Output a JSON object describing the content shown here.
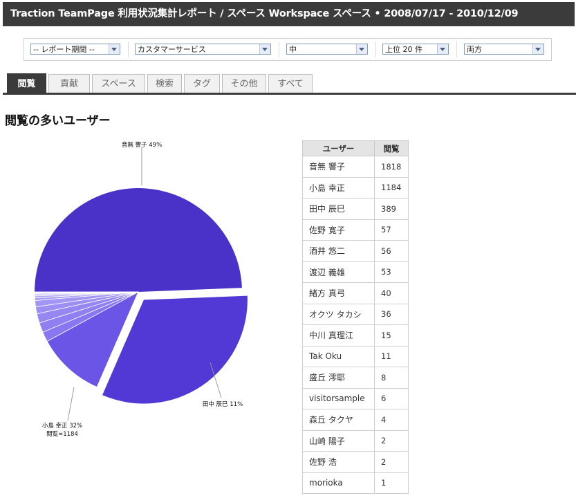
{
  "header": {
    "title": "Traction TeamPage 利用状況集計レポート / スペース Workspace スペース • 2008/07/17 - 2010/12/09"
  },
  "filters": [
    {
      "value": "-- レポート期間 --"
    },
    {
      "value": "カスタマーサービス"
    },
    {
      "value": "中"
    },
    {
      "value": "上位 20 件"
    },
    {
      "value": "両方"
    }
  ],
  "tabs": [
    {
      "label": "閲覧",
      "active": true
    },
    {
      "label": "貢献"
    },
    {
      "label": "スペース"
    },
    {
      "label": "検索"
    },
    {
      "label": "タグ"
    },
    {
      "label": "その他"
    },
    {
      "label": "すべて"
    }
  ],
  "section_title": "閲覧の多いユーザー",
  "chart_data": {
    "type": "pie",
    "colors": {
      "main": "#4a32c8",
      "second": "#5238d4",
      "third": "#6a55e6",
      "light_start": "#8877f0",
      "light_end": "#d8d2fb"
    },
    "slices": [
      {
        "name": "音無 響子",
        "value": 1818
      },
      {
        "name": "小島 幸正",
        "value": 1184
      },
      {
        "name": "田中 辰巳",
        "value": 389
      },
      {
        "name": "佐野 寛子",
        "value": 57
      },
      {
        "name": "酒井 悠二",
        "value": 56
      },
      {
        "name": "渡辺 義雄",
        "value": 53
      },
      {
        "name": "緒方 真弓",
        "value": 40
      },
      {
        "name": "オクツ タカシ",
        "value": 36
      },
      {
        "name": "中川 真理江",
        "value": 15
      },
      {
        "name": "Tak Oku",
        "value": 11
      },
      {
        "name": "盛丘 澪耶",
        "value": 8
      },
      {
        "name": "visitorsample",
        "value": 6
      },
      {
        "name": "森丘 タクヤ",
        "value": 4
      },
      {
        "name": "山崎 陽子",
        "value": 2
      },
      {
        "name": "佐野 浩",
        "value": 2
      },
      {
        "name": "morioka",
        "value": 1
      }
    ],
    "labels": {
      "first": "音無 響子 49%",
      "second_line1": "小島 幸正 32%",
      "second_line2": "閲覧=1184",
      "third": "田中 辰巳 11%"
    }
  },
  "table": {
    "headers": [
      "ユーザー",
      "閲覧"
    ],
    "rows": [
      [
        "音無 響子",
        "1818"
      ],
      [
        "小島 幸正",
        "1184"
      ],
      [
        "田中 辰巳",
        "389"
      ],
      [
        "佐野 寛子",
        "57"
      ],
      [
        "酒井 悠二",
        "56"
      ],
      [
        "渡辺 義雄",
        "53"
      ],
      [
        "緒方 真弓",
        "40"
      ],
      [
        "オクツ タカシ",
        "36"
      ],
      [
        "中川 真理江",
        "15"
      ],
      [
        "Tak Oku",
        "11"
      ],
      [
        "盛丘 澪耶",
        "8"
      ],
      [
        "visitorsample",
        "6"
      ],
      [
        "森丘 タクヤ",
        "4"
      ],
      [
        "山崎 陽子",
        "2"
      ],
      [
        "佐野 浩",
        "2"
      ],
      [
        "morioka",
        "1"
      ]
    ]
  }
}
